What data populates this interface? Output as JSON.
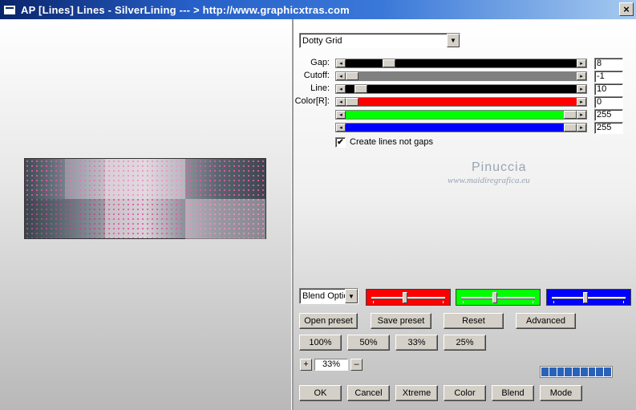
{
  "window": {
    "title": "AP [Lines]  Lines - SilverLining     --- > http://www.graphicxtras.com",
    "close_label": "×"
  },
  "preset_dropdown": {
    "value": "Dotty Grid",
    "arrow": "▼"
  },
  "sliders": [
    {
      "label": "Gap:",
      "value": "8",
      "track_color": "#000000",
      "level": 0.17
    },
    {
      "label": "Cutoff:",
      "value": "-1",
      "track_color": "#808080",
      "level": 0.0
    },
    {
      "label": "Line:",
      "value": "10",
      "track_color": "#000000",
      "level": 0.04
    },
    {
      "label": "Color[R]:",
      "value": "0",
      "track_color": "#ff0000",
      "level": 0.0
    },
    {
      "label": "",
      "value": "255",
      "track_color": "#00ff00",
      "level": 1.0
    },
    {
      "label": "",
      "value": "255",
      "track_color": "#0000ff",
      "level": 1.0
    }
  ],
  "create_lines": {
    "label": "Create lines not gaps",
    "checked": true,
    "mark": "✔"
  },
  "watermark": {
    "title": "Pinuccia",
    "subtitle": "www.maidiregrafica.eu"
  },
  "blend_dropdown": {
    "value": "Blend Optio",
    "arrow": "▼"
  },
  "color_sliders": [
    {
      "name": "red",
      "color": "#ff0000",
      "level": 0.45
    },
    {
      "name": "green",
      "color": "#00ff00",
      "level": 0.45
    },
    {
      "name": "blue",
      "color": "#0000ff",
      "level": 0.45
    }
  ],
  "buttons": {
    "open_preset": "Open preset",
    "save_preset": "Save preset",
    "reset": "Reset",
    "advanced": "Advanced",
    "zoom_100": "100%",
    "zoom_50": "50%",
    "zoom_33": "33%",
    "zoom_25": "25%",
    "ok": "OK",
    "cancel": "Cancel",
    "xtreme": "Xtreme",
    "color": "Color",
    "blend": "Blend",
    "mode": "Mode"
  },
  "zoom": {
    "plus": "+",
    "minus": "–",
    "value": "33%"
  },
  "progress": {
    "segments": 9
  }
}
